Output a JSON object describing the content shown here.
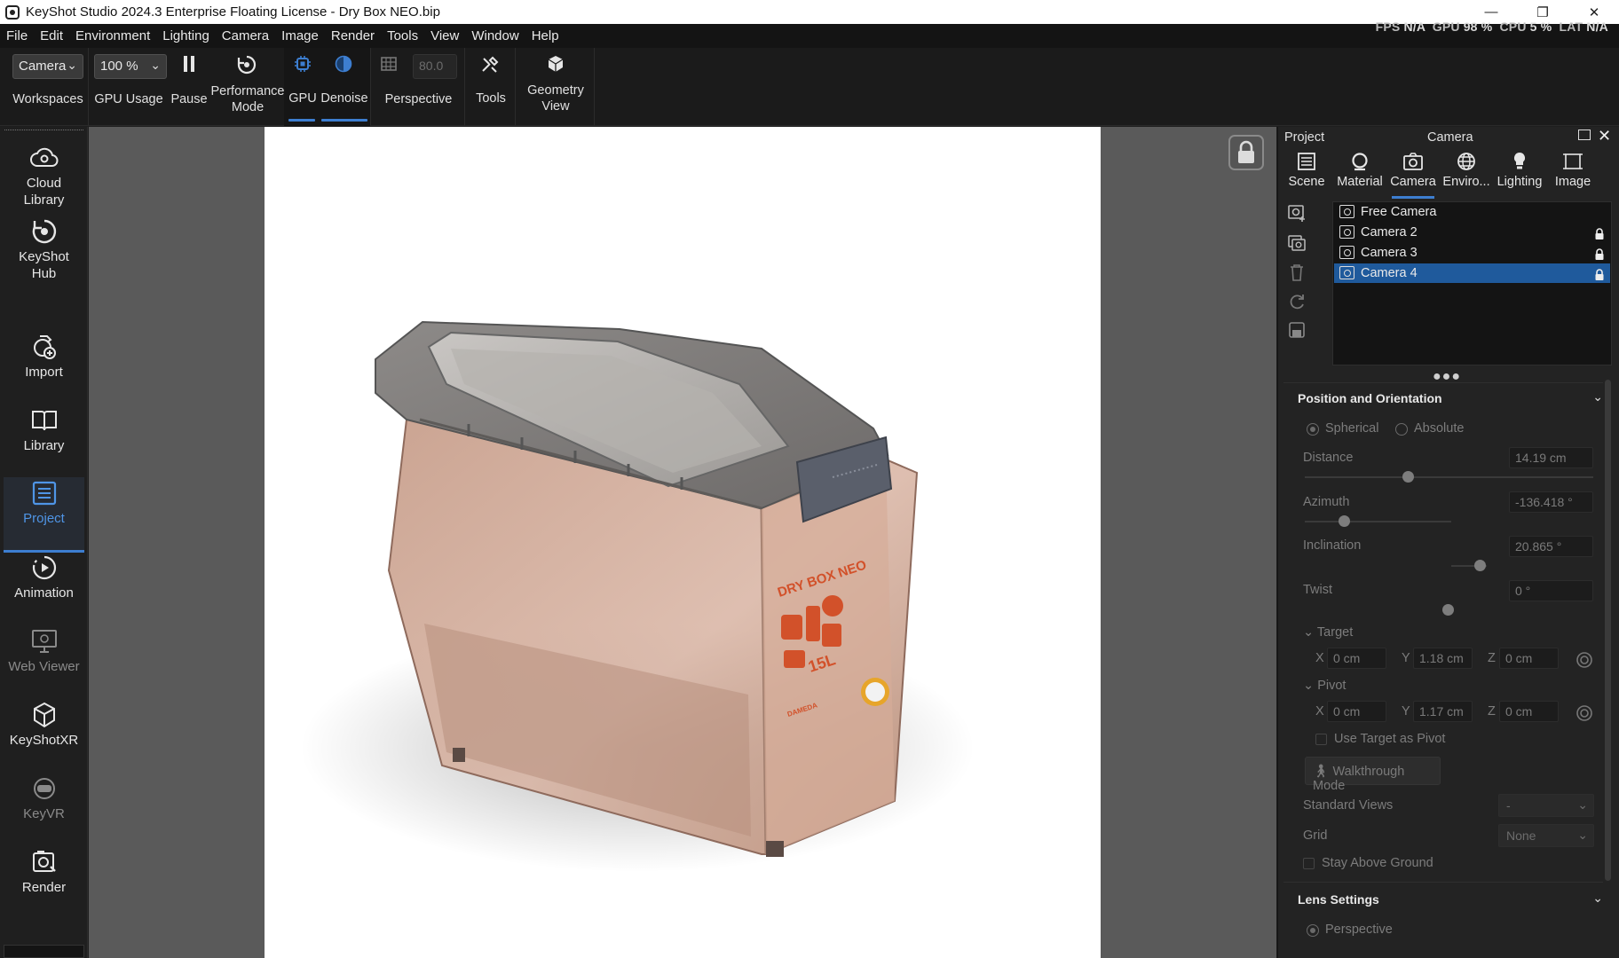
{
  "window": {
    "title": "KeyShot Studio 2024.3 Enterprise Floating License  -  Dry Box NEO.bip",
    "minimize": "—",
    "restore": "❐",
    "close": "✕"
  },
  "menu": [
    "File",
    "Edit",
    "Environment",
    "Lighting",
    "Camera",
    "Image",
    "Render",
    "Tools",
    "View",
    "Window",
    "Help"
  ],
  "stats": {
    "fps_label": "FPS",
    "fps": "N/A",
    "gpu_label": "GPU",
    "gpu": "98 %",
    "cpu_label": "CPU",
    "cpu": "5 %",
    "lat_label": "LAT",
    "lat": "N/A"
  },
  "toolbar": {
    "workspace_value": "Camera",
    "workspaces_label": "Workspaces",
    "gpu_usage_value": "100 %",
    "gpu_usage_label": "GPU Usage",
    "pause_label": "Pause",
    "performance_label_1": "Performance",
    "performance_label_2": "Mode",
    "gpu_label": "GPU",
    "denoise_label": "Denoise",
    "fov_value": "80.0",
    "perspective_label": "Perspective",
    "tools_label": "Tools",
    "geometry_label_1": "Geometry",
    "geometry_label_2": "View"
  },
  "sidebar": {
    "cloud_1": "Cloud",
    "cloud_2": "Library",
    "hub_1": "KeyShot",
    "hub_2": "Hub",
    "import": "Import",
    "library": "Library",
    "project": "Project",
    "animation": "Animation",
    "webviewer": "Web Viewer",
    "keyshotxr": "KeyShotXR",
    "keyvr": "KeyVR",
    "render": "Render"
  },
  "panel": {
    "project_label": "Project",
    "camera_header": "Camera",
    "tabs": [
      "Scene",
      "Material",
      "Camera",
      "Enviro...",
      "Lighting",
      "Image"
    ],
    "cameras": [
      "Free Camera",
      "Camera 2",
      "Camera 3",
      "Camera 4"
    ],
    "section_position": "Position and Orientation",
    "spherical": "Spherical",
    "absolute": "Absolute",
    "distance_label": "Distance",
    "distance": "14.19 cm",
    "azimuth_label": "Azimuth",
    "azimuth": "-136.418 °",
    "inclination_label": "Inclination",
    "inclination": "20.865 °",
    "twist_label": "Twist",
    "twist": "0 °",
    "target_label": "Target",
    "target_x": "0 cm",
    "target_y": "1.18 cm",
    "target_z": "0 cm",
    "pivot_label": "Pivot",
    "pivot_x": "0 cm",
    "pivot_y": "1.17 cm",
    "pivot_z": "0 cm",
    "x": "X",
    "y": "Y",
    "z": "Z",
    "use_target_pivot": "Use Target as Pivot",
    "walkthrough": "Walkthrough Mode",
    "standard_views_label": "Standard Views",
    "standard_views_value": "-",
    "grid_label": "Grid",
    "grid_value": "None",
    "stay_above": "Stay Above Ground",
    "section_lens": "Lens Settings",
    "lens_perspective": "Perspective"
  },
  "product": {
    "brand_text": "DRY BOX NEO",
    "capacity": "15L",
    "logo_text": "DAMEDA"
  },
  "colors": {
    "accent": "#3d7ed0",
    "selection": "#1f5a9c",
    "box_body": "#c89a84",
    "box_label": "#d2512a"
  }
}
